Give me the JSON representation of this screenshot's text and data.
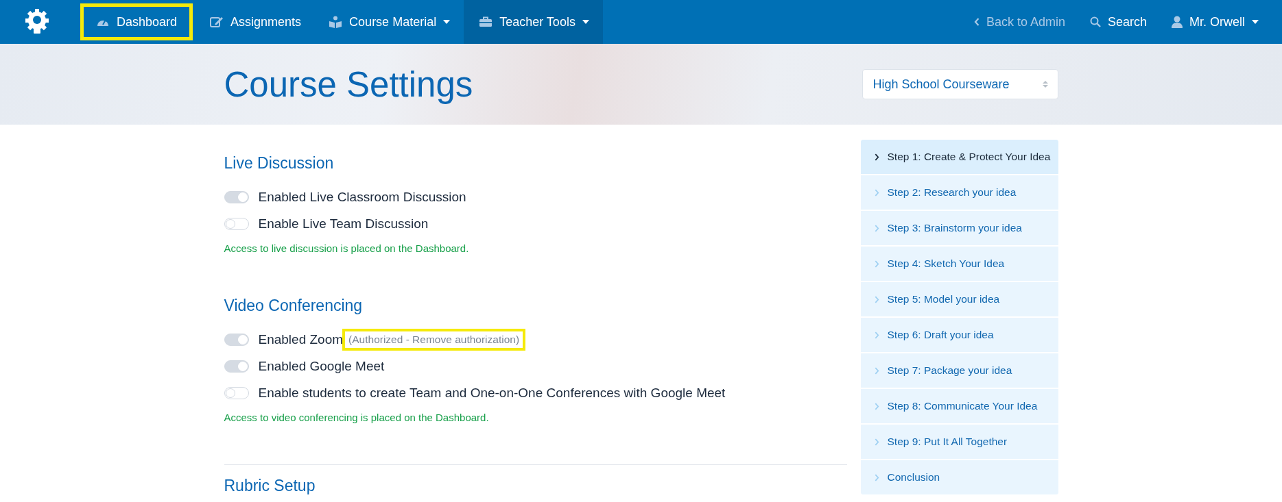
{
  "navbar": {
    "items": [
      {
        "label": "Dashboard",
        "kind": "gauge",
        "dropdown": false,
        "selected": false,
        "highlighted": true
      },
      {
        "label": "Assignments",
        "kind": "edit",
        "dropdown": false,
        "selected": false,
        "highlighted": false
      },
      {
        "label": "Course Material",
        "kind": "book",
        "dropdown": true,
        "selected": false,
        "highlighted": false
      },
      {
        "label": "Teacher Tools",
        "kind": "toolbox",
        "dropdown": true,
        "selected": true,
        "highlighted": false
      }
    ],
    "right": [
      {
        "label": "Back to Admin",
        "kind": "back",
        "dropdown": false
      },
      {
        "label": "Search",
        "kind": "search",
        "dropdown": false
      },
      {
        "label": "Mr. Orwell",
        "kind": "user",
        "dropdown": true
      }
    ]
  },
  "header": {
    "title": "Course Settings",
    "course_select": {
      "value": "High School Courseware"
    }
  },
  "sections": [
    {
      "title": "Live Discussion",
      "toggles": [
        {
          "label": "Enabled Live Classroom Discussion",
          "on": true
        },
        {
          "label": "Enable Live Team Discussion",
          "on": false
        }
      ],
      "note": "Access to live discussion is placed on the Dashboard."
    },
    {
      "title": "Video Conferencing",
      "toggles": [
        {
          "label": "Enabled Zoom",
          "on": true,
          "status": "(Authorized - Remove authorization)",
          "highlighted": true
        },
        {
          "label": "Enabled Google Meet",
          "on": true
        },
        {
          "label": "Enable students to create Team and One-on-One Conferences with Google Meet",
          "on": false
        }
      ],
      "note": "Access to video conferencing is placed on the Dashboard."
    },
    {
      "title": "Rubric Setup"
    }
  ],
  "steps": [
    {
      "label": "Step 1: Create & Protect Your Idea",
      "selected": true
    },
    {
      "label": "Step 2: Research your idea",
      "selected": false
    },
    {
      "label": "Step 3: Brainstorm your idea",
      "selected": false
    },
    {
      "label": "Step 4: Sketch Your Idea",
      "selected": false
    },
    {
      "label": "Step 5: Model your idea",
      "selected": false
    },
    {
      "label": "Step 6: Draft your idea",
      "selected": false
    },
    {
      "label": "Step 7: Package your idea",
      "selected": false
    },
    {
      "label": "Step 8: Communicate Your Idea",
      "selected": false
    },
    {
      "label": "Step 9: Put It All Together",
      "selected": false
    },
    {
      "label": "Conclusion",
      "selected": false
    }
  ]
}
